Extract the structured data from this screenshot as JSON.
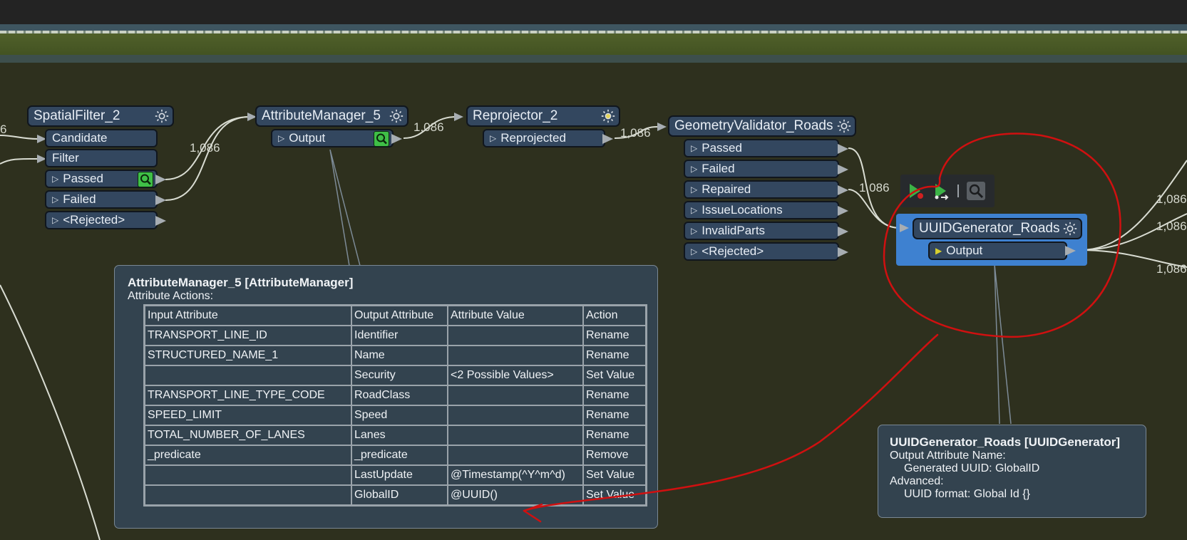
{
  "canvas": {
    "colors": {
      "background": "#2e301e",
      "node": "#33475f",
      "selection": "#3e81d0",
      "annotation": "#d01010",
      "inspector": "#3fbf47"
    },
    "left_counts": [
      "6"
    ]
  },
  "nodes": {
    "spatialfilter": {
      "title": "SpatialFilter_2",
      "inputs": [
        "Candidate",
        "Filter"
      ],
      "outputs": [
        "Passed",
        "Failed",
        "<Rejected>"
      ]
    },
    "attributemanager": {
      "title": "AttributeManager_5",
      "outputs": [
        "Output"
      ]
    },
    "reprojector": {
      "title": "Reprojector_2",
      "outputs": [
        "Reprojected"
      ]
    },
    "geometryvalidator": {
      "title": "GeometryValidator_Roads",
      "outputs": [
        "Passed",
        "Failed",
        "Repaired",
        "IssueLocations",
        "InvalidParts",
        "<Rejected>"
      ]
    },
    "uuidgenerator": {
      "title": "UUIDGenerator_Roads",
      "outputs": [
        "Output"
      ]
    }
  },
  "feature_counts": {
    "spatial_to_attr": "1,086",
    "attr_to_reproj": "1,086",
    "reproj_to_geom": "1,086",
    "geom_repaired_to_uuid": "1,086",
    "uuid_out_1": "1,086",
    "uuid_out_2": "1,086",
    "uuid_out_3": "1,086"
  },
  "icons": {
    "gear": "gear-icon",
    "inspect": "magnifier-icon",
    "run_to_here": "run-to-this-icon",
    "run_from_here": "run-from-this-icon",
    "inspect_cache": "inspect-cache-icon"
  },
  "tooltip_attr": {
    "title": "AttributeManager_5 [AttributeManager]",
    "subtitle": "Attribute Actions:",
    "columns": [
      "Input Attribute",
      "Output Attribute",
      "Attribute Value",
      "Action"
    ],
    "rows": [
      [
        "TRANSPORT_LINE_ID",
        "Identifier",
        "",
        "Rename"
      ],
      [
        "STRUCTURED_NAME_1",
        "Name",
        "",
        "Rename"
      ],
      [
        "",
        "Security",
        "<2 Possible Values>",
        "Set Value"
      ],
      [
        "TRANSPORT_LINE_TYPE_CODE",
        "RoadClass",
        "",
        "Rename"
      ],
      [
        "SPEED_LIMIT",
        "Speed",
        "",
        "Rename"
      ],
      [
        "TOTAL_NUMBER_OF_LANES",
        "Lanes",
        "",
        "Rename"
      ],
      [
        "_predicate",
        "_predicate",
        "",
        "Remove"
      ],
      [
        "",
        "LastUpdate",
        "@Timestamp(^Y^m^d)",
        "Set Value"
      ],
      [
        "",
        "GlobalID",
        "@UUID()",
        "Set Value"
      ]
    ]
  },
  "tooltip_uuid": {
    "title": "UUIDGenerator_Roads [UUIDGenerator]",
    "lines": [
      "Output Attribute Name:",
      "    Generated UUID: GlobalID",
      "Advanced:",
      "    UUID format: Global Id {}"
    ]
  }
}
